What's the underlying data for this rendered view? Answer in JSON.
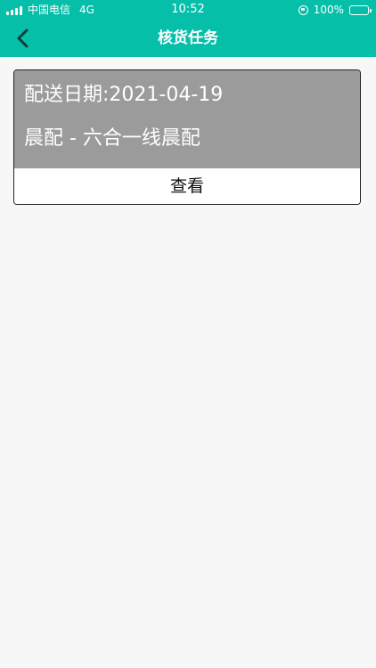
{
  "status_bar": {
    "carrier": "中国电信",
    "network": "4G",
    "time": "10:52",
    "battery": "100%",
    "icons": [
      "signal-icon",
      "orientation-lock-icon",
      "battery-icon"
    ]
  },
  "nav": {
    "title": "核货任务",
    "back_icon": "chevron-left-icon"
  },
  "task_card": {
    "date_text": "配送日期:2021-04-19",
    "route_text": "晨配 - 六合一线晨配",
    "view_label": "查看"
  },
  "colors": {
    "header": "#05bfa9",
    "card_info_bg": "#9b9b9b",
    "page_bg": "#f7f7f7"
  }
}
